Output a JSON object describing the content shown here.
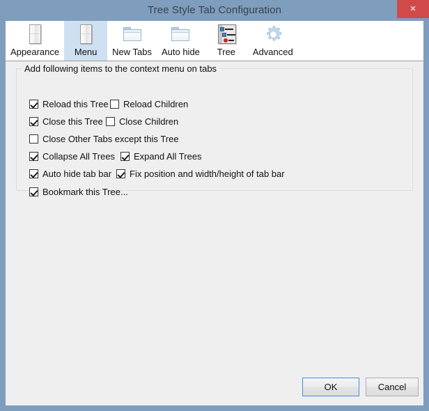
{
  "window": {
    "title": "Tree Style Tab Configuration",
    "close_label": "×",
    "close_icon": "close-icon",
    "titlebar_color": "#7f9dbd",
    "close_button_color": "#d04a4a",
    "client_background": "#efefef"
  },
  "toolbar": {
    "selected": "Menu",
    "selected_color": "#cfe0f2",
    "items": [
      {
        "label": "Appearance",
        "icon": "panel-icon",
        "selected": false
      },
      {
        "label": "Menu",
        "icon": "panel-icon",
        "selected": true
      },
      {
        "label": "New Tabs",
        "icon": "folder-icon",
        "selected": false
      },
      {
        "label": "Auto hide",
        "icon": "folder-icon",
        "selected": false
      },
      {
        "label": "Tree",
        "icon": "tree-list-icon",
        "selected": false
      },
      {
        "label": "Advanced",
        "icon": "gear-icon",
        "selected": false
      }
    ]
  },
  "group": {
    "title": "Add following items to the context menu on tabs",
    "checkboxes": [
      {
        "label": "Reload this Tree",
        "checked": true,
        "col": 0,
        "row": 0
      },
      {
        "label": "Reload Children",
        "checked": false,
        "col": 1,
        "row": 0
      },
      {
        "label": "Close this Tree",
        "checked": true,
        "col": 0,
        "row": 1
      },
      {
        "label": "Close Children",
        "checked": false,
        "col": 1,
        "row": 1
      },
      {
        "label": "Close Other Tabs except this Tree",
        "checked": false,
        "col": 0,
        "row": 2
      },
      {
        "label": "Collapse All Trees",
        "checked": true,
        "col": 0,
        "row": 3
      },
      {
        "label": "Expand All Trees",
        "checked": true,
        "col": 1,
        "row": 3
      },
      {
        "label": "Auto hide tab bar",
        "checked": true,
        "col": 0,
        "row": 4
      },
      {
        "label": "Fix position and width/height of tab bar",
        "checked": true,
        "col": 1,
        "row": 4
      },
      {
        "label": "Bookmark this Tree...",
        "checked": true,
        "col": 0,
        "row": 5
      }
    ]
  },
  "footer": {
    "ok_label": "OK",
    "cancel_label": "Cancel",
    "default_button": "OK",
    "focus_color": "#3c8ede"
  }
}
